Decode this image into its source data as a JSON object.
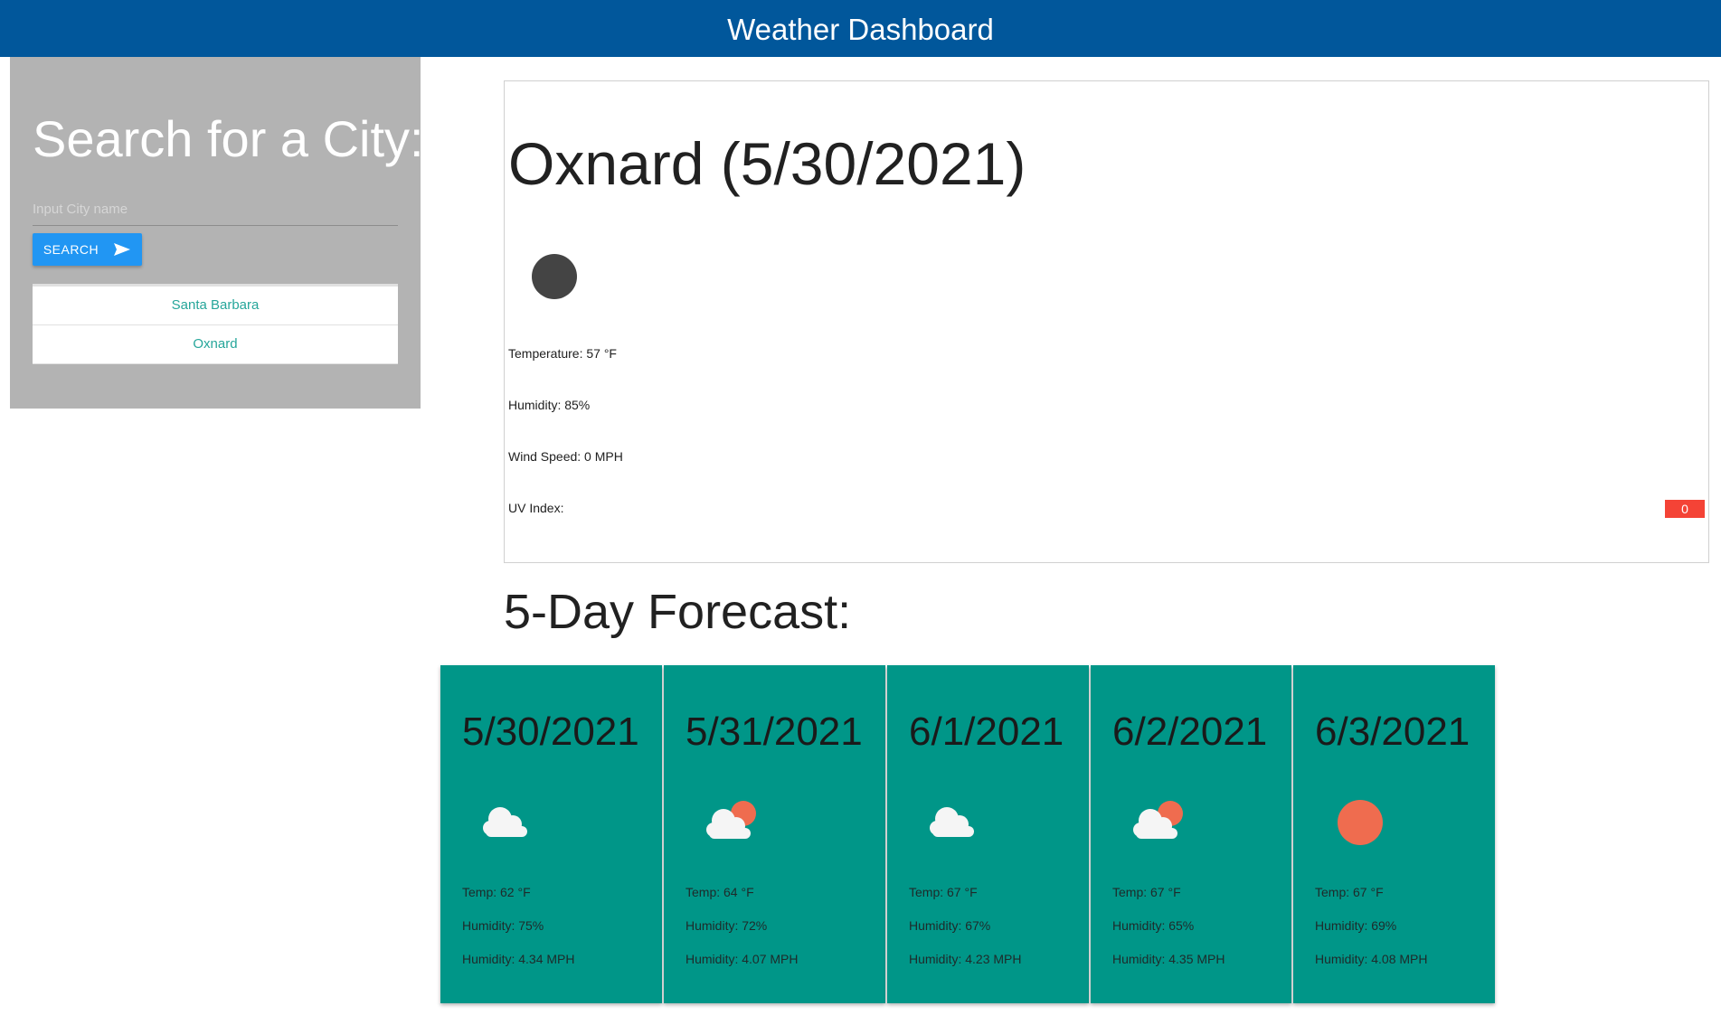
{
  "header": {
    "title": "Weather Dashboard"
  },
  "sidebar": {
    "title": "Search for a City:",
    "input_placeholder": "Input City name",
    "input_value": "",
    "search_label": "SEARCH",
    "history": [
      {
        "label": "Santa Barbara"
      },
      {
        "label": "Oxnard"
      }
    ]
  },
  "current": {
    "city_title": "Oxnard (5/30/2021)",
    "icon": "dark-circle-icon",
    "temperature": "Temperature: 57 °F",
    "humidity": "Humidity: 85%",
    "wind": "Wind Speed: 0 MPH",
    "uv_label": "UV Index:",
    "uv_value": "0",
    "uv_color": "#f44336"
  },
  "forecast": {
    "title": "5-Day Forecast:",
    "days": [
      {
        "date": "5/30/2021",
        "icon": "cloud-icon",
        "temp": "Temp: 62 °F",
        "humidity": "Humidity: 75%",
        "wind": "Humidity: 4.34 MPH"
      },
      {
        "date": "5/31/2021",
        "icon": "cloud-sun-icon",
        "temp": "Temp: 64 °F",
        "humidity": "Humidity: 72%",
        "wind": "Humidity: 4.07 MPH"
      },
      {
        "date": "6/1/2021",
        "icon": "cloud-icon",
        "temp": "Temp: 67 °F",
        "humidity": "Humidity: 67%",
        "wind": "Humidity: 4.23 MPH"
      },
      {
        "date": "6/2/2021",
        "icon": "cloud-sun-icon",
        "temp": "Temp: 67 °F",
        "humidity": "Humidity: 65%",
        "wind": "Humidity: 4.35 MPH"
      },
      {
        "date": "6/3/2021",
        "icon": "sun-icon",
        "temp": "Temp: 67 °F",
        "humidity": "Humidity: 69%",
        "wind": "Humidity: 4.08 MPH"
      }
    ]
  },
  "colors": {
    "header_bg": "#01579b",
    "sidebar_bg": "#b3b3b3",
    "button_bg": "#2196f3",
    "link": "#26a69a",
    "forecast_card_bg": "#009688",
    "sun": "#ef6c4f"
  }
}
